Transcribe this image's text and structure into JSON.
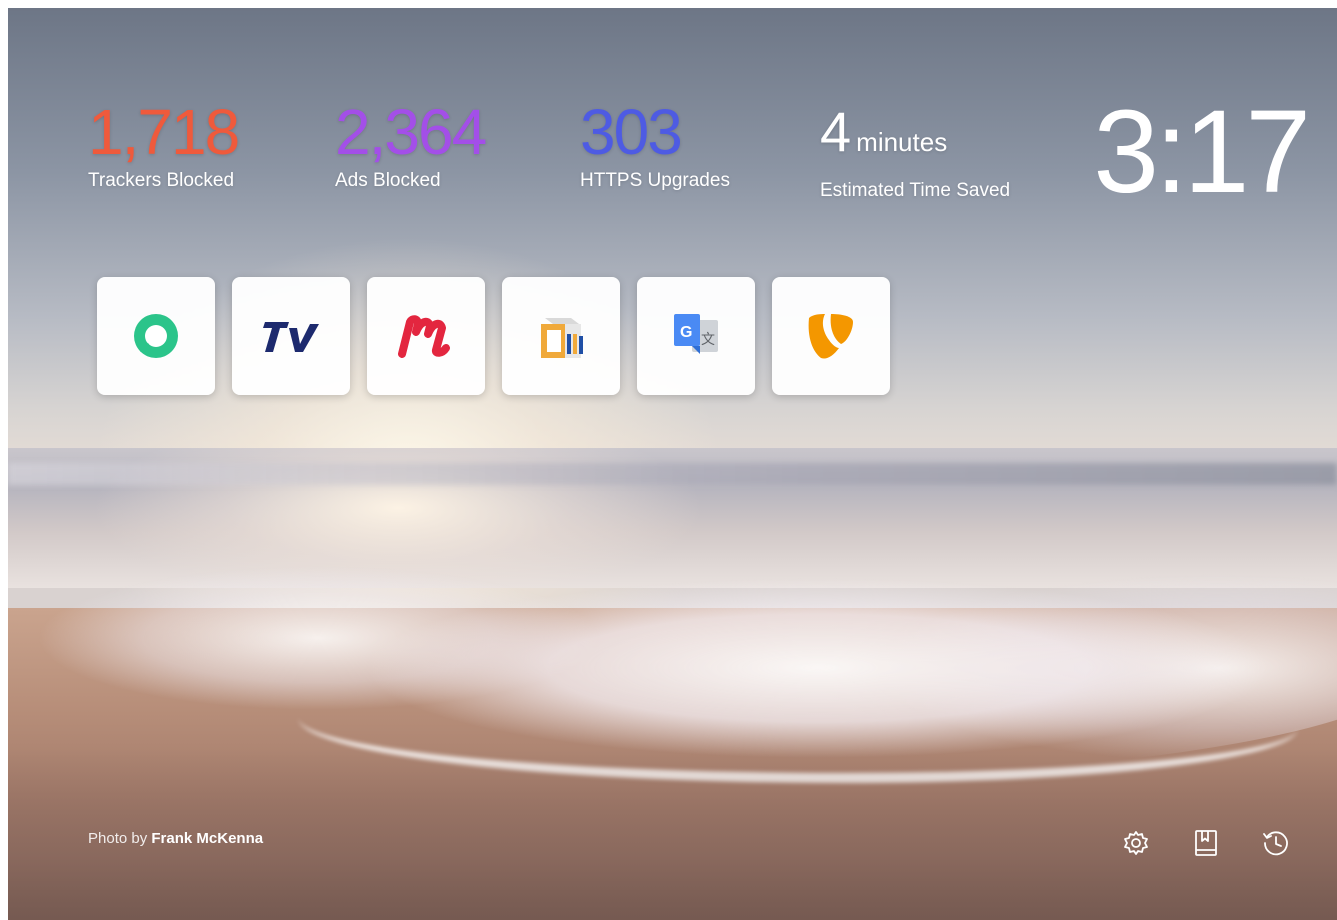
{
  "stats": {
    "trackers": {
      "value": "1,718",
      "label": "Trackers Blocked",
      "color": "#ef5a3c"
    },
    "ads": {
      "value": "2,364",
      "label": "Ads Blocked",
      "color": "#a34fe8"
    },
    "https": {
      "value": "303",
      "label": "HTTPS Upgrades",
      "color": "#4e5be3"
    },
    "time": {
      "value": "4",
      "unit": "minutes",
      "label": "Estimated Time Saved",
      "color": "#ffffff"
    }
  },
  "clock": {
    "time": "3:17"
  },
  "top_sites": [
    {
      "icon": "chat-bubble-green-icon"
    },
    {
      "icon": "tv-logo-icon"
    },
    {
      "icon": "m-logo-red-icon"
    },
    {
      "icon": "cb-box-logo-icon"
    },
    {
      "icon": "google-translate-icon"
    },
    {
      "icon": "typo3-icon"
    }
  ],
  "footer": {
    "credit_prefix": "Photo by ",
    "credit_author": "Frank McKenna",
    "icons": [
      "gear-icon",
      "bookmarks-icon",
      "history-icon"
    ]
  }
}
